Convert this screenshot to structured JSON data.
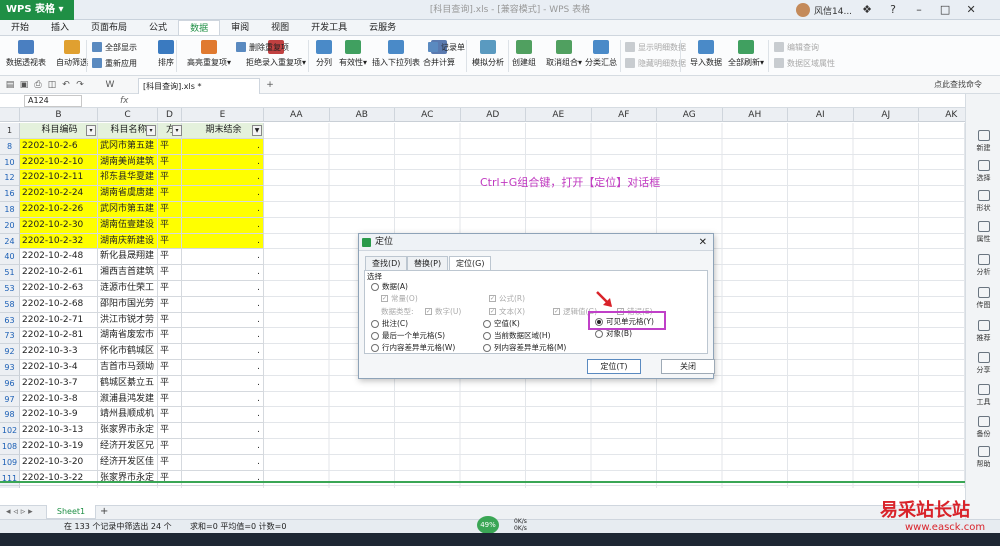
{
  "app": {
    "name": "WPS 表格",
    "window_title": "[科目查询].xls - [兼容模式] - WPS 表格",
    "user": "风信14..."
  },
  "menu": [
    "开始",
    "插入",
    "页面布局",
    "公式",
    "数据",
    "审阅",
    "视图",
    "开发工具",
    "云服务"
  ],
  "active_menu": "数据",
  "ribbon": {
    "large": [
      {
        "label": "数据透视表",
        "icon": "pivot-icon",
        "color": "#4a7fc1"
      },
      {
        "label": "自动筛选",
        "icon": "filter-icon",
        "color": "#e0a030"
      },
      {
        "label": "排序",
        "icon": "sort-icon",
        "color": "#3a7ac0"
      },
      {
        "label": "高亮重复项▾",
        "icon": "highlight-dup-icon",
        "color": "#e07a30"
      },
      {
        "label": "拒绝录入重复项▾",
        "icon": "reject-dup-icon",
        "color": "#c04040"
      },
      {
        "label": "分列",
        "icon": "split-icon",
        "color": "#4a8ac8"
      },
      {
        "label": "有效性▾",
        "icon": "validity-icon",
        "color": "#40a060"
      },
      {
        "label": "插入下拉列表",
        "icon": "dropdown-list-icon",
        "color": "#4a8ac8"
      },
      {
        "label": "合并计算",
        "icon": "consolidate-icon",
        "color": "#5a7ab0"
      },
      {
        "label": "模拟分析",
        "icon": "whatif-icon",
        "color": "#5a9ac0"
      },
      {
        "label": "创建组",
        "icon": "group-icon",
        "color": "#50a060"
      },
      {
        "label": "取消组合▾",
        "icon": "ungroup-icon",
        "color": "#50a060"
      },
      {
        "label": "分类汇总",
        "icon": "subtotal-icon",
        "color": "#4a8ac8"
      },
      {
        "label": "导入数据",
        "icon": "import-icon",
        "color": "#4a8ac8"
      },
      {
        "label": "全部刷新▾",
        "icon": "refresh-icon",
        "color": "#40a060"
      }
    ],
    "small": [
      {
        "label": "全部显示",
        "icon": "show-all-icon",
        "disabled": false
      },
      {
        "label": "重新应用",
        "icon": "reapply-icon",
        "disabled": false
      },
      {
        "label": "删除重复项",
        "icon": "remove-dup-icon",
        "disabled": false
      },
      {
        "label": "记录单",
        "icon": "record-icon",
        "disabled": false
      },
      {
        "label": "显示明细数据",
        "icon": "show-detail-icon",
        "disabled": true
      },
      {
        "label": "隐藏明细数据",
        "icon": "hide-detail-icon",
        "disabled": true
      },
      {
        "label": "编辑查询",
        "icon": "edit-query-icon",
        "disabled": true
      },
      {
        "label": "数据区域属性",
        "icon": "range-props-icon",
        "disabled": true
      }
    ]
  },
  "doc_tab": "[科目查询].xls *",
  "quickbar_right": "点此查找命令",
  "namebox": "A124",
  "fx": "fx",
  "columns": {
    "data_headers": [
      "B",
      "C",
      "D",
      "E"
    ],
    "extra_headers": [
      "AA",
      "AB",
      "AC",
      "AD",
      "AE",
      "AF",
      "AG",
      "AH",
      "AI",
      "AJ",
      "AK"
    ]
  },
  "header_row": {
    "row": "1",
    "cells": [
      "科目编码",
      "科目名称",
      "方",
      "期末结余"
    ]
  },
  "rows": [
    {
      "r": "8",
      "code": "2202-10-2-6",
      "name": "武冈市第五建",
      "dir": "平",
      "bal": ".",
      "hl": true
    },
    {
      "r": "10",
      "code": "2202-10-2-10",
      "name": "湖南美尚建筑",
      "dir": "平",
      "bal": ".",
      "hl": true
    },
    {
      "r": "12",
      "code": "2202-10-2-11",
      "name": "祁东县华夏建",
      "dir": "平",
      "bal": ".",
      "hl": true
    },
    {
      "r": "16",
      "code": "2202-10-2-24",
      "name": "湖南省虞唐建",
      "dir": "平",
      "bal": ".",
      "hl": true
    },
    {
      "r": "18",
      "code": "2202-10-2-26",
      "name": "武冈市第五建",
      "dir": "平",
      "bal": ".",
      "hl": true
    },
    {
      "r": "20",
      "code": "2202-10-2-30",
      "name": "湖南伍壹建设",
      "dir": "平",
      "bal": ".",
      "hl": true
    },
    {
      "r": "24",
      "code": "2202-10-2-32",
      "name": "湖南庆新建设",
      "dir": "平",
      "bal": ".",
      "hl": true
    },
    {
      "r": "40",
      "code": "2202-10-2-48",
      "name": "新化县晟翔建",
      "dir": "平",
      "bal": ".",
      "hl": false
    },
    {
      "r": "51",
      "code": "2202-10-2-61",
      "name": "湘西吉首建筑",
      "dir": "平",
      "bal": ".",
      "hl": false
    },
    {
      "r": "53",
      "code": "2202-10-2-63",
      "name": "涟源市仕荣工",
      "dir": "平",
      "bal": ".",
      "hl": false
    },
    {
      "r": "58",
      "code": "2202-10-2-68",
      "name": "邵阳市国光劳",
      "dir": "平",
      "bal": ".",
      "hl": false
    },
    {
      "r": "63",
      "code": "2202-10-2-71",
      "name": "洪江市锐才劳",
      "dir": "平",
      "bal": ".",
      "hl": false
    },
    {
      "r": "73",
      "code": "2202-10-2-81",
      "name": "湖南省废宏市",
      "dir": "平",
      "bal": ".",
      "hl": false
    },
    {
      "r": "92",
      "code": "2202-10-3-3",
      "name": "怀化市鹤城区",
      "dir": "平",
      "bal": ".",
      "hl": false
    },
    {
      "r": "93",
      "code": "2202-10-3-4",
      "name": "吉首市马颈坳",
      "dir": "平",
      "bal": ".",
      "hl": false
    },
    {
      "r": "96",
      "code": "2202-10-3-7",
      "name": "鹤城区綦立五",
      "dir": "平",
      "bal": ".",
      "hl": false
    },
    {
      "r": "97",
      "code": "2202-10-3-8",
      "name": "溆浦县鸿发建",
      "dir": "平",
      "bal": ".",
      "hl": false
    },
    {
      "r": "98",
      "code": "2202-10-3-9",
      "name": "靖州县顺成机",
      "dir": "平",
      "bal": ".",
      "hl": false
    },
    {
      "r": "102",
      "code": "2202-10-3-13",
      "name": "张家界市永定",
      "dir": "平",
      "bal": ".",
      "hl": false
    },
    {
      "r": "108",
      "code": "2202-10-3-19",
      "name": "经济开发区兄",
      "dir": "平",
      "bal": ".",
      "hl": false
    },
    {
      "r": "109",
      "code": "2202-10-3-20",
      "name": "经济开发区佳",
      "dir": "平",
      "bal": ".",
      "hl": false
    },
    {
      "r": "111",
      "code": "2202-10-3-22",
      "name": "张家界市永定",
      "dir": "平",
      "bal": ".",
      "hl": false
    },
    {
      "r": "133",
      "code": "",
      "name": "",
      "dir": "",
      "bal": "",
      "hl": false
    },
    {
      "r": "134",
      "code": "",
      "name": "",
      "dir": "",
      "bal": "",
      "hl": false
    }
  ],
  "annotation": "Ctrl+G组合键，打开【定位】对话框",
  "dialog": {
    "title": "定位",
    "tabs": [
      "查找(D)",
      "替换(P)",
      "定位(G)"
    ],
    "active_tab": "定位(G)",
    "group_label": "选择",
    "opt_data": "数据(A)",
    "sub_constant": "常量(O)",
    "sub_formula": "公式(R)",
    "type_label": "数据类型:",
    "types": [
      "数字(U)",
      "文本(X)",
      "逻辑值(G)",
      "错误(E)"
    ],
    "options_col1": [
      "批注(C)",
      "最后一个单元格(S)",
      "行内容差异单元格(W)"
    ],
    "options_col2": [
      "空值(K)",
      "当前数据区域(H)",
      "列内容差异单元格(M)"
    ],
    "options_col3": [
      "可见单元格(Y)",
      "对象(B)"
    ],
    "selected": "可见单元格(Y)",
    "ok_label": "定位(T)",
    "close_label": "关闭"
  },
  "right_panel": [
    "新建",
    "选择",
    "形状",
    "属性",
    "分析",
    "传图",
    "推荐",
    "分享",
    "工具",
    "备份",
    "帮助"
  ],
  "sheet_tab": "Sheet1",
  "status": {
    "text": "在 133 个记录中筛选出 24 个",
    "summary": "求和=0  平均值=0  计数=0",
    "percent": "49%",
    "speed_up": "0K/s",
    "speed_down": "0K/s"
  },
  "watermark": {
    "title": "易采站长站",
    "url": "www.easck.com"
  },
  "colors": {
    "accent": "#1f8f45",
    "highlight_row": "#ffff00",
    "annotation": "#c039c0",
    "annotation_box": "#c040c8",
    "watermark": "#d9232a"
  }
}
